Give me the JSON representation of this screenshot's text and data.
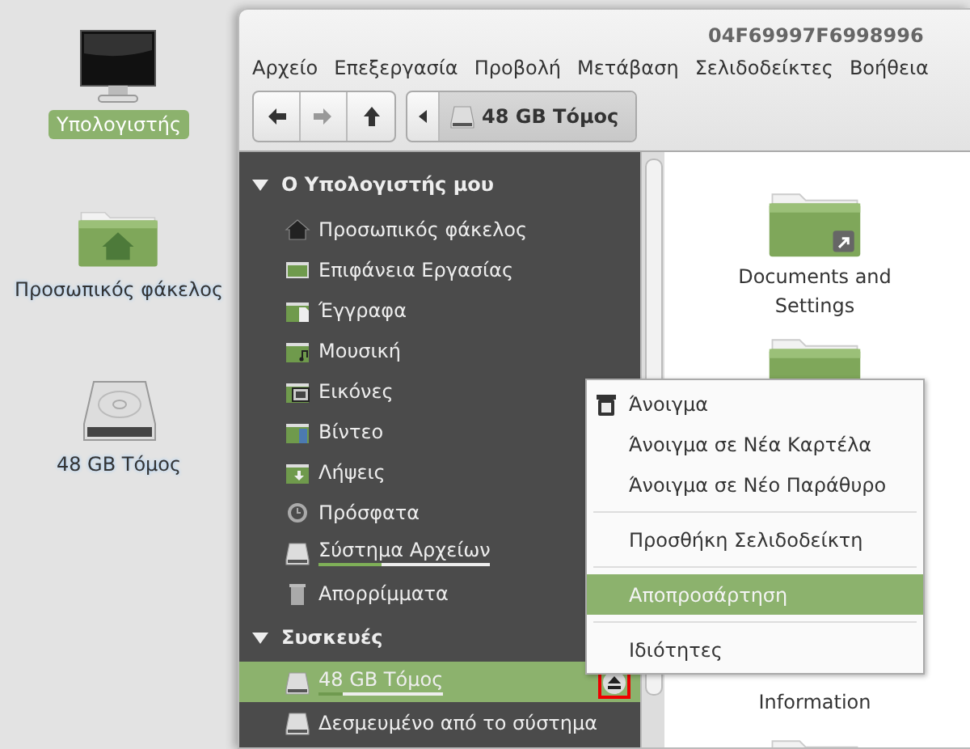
{
  "desktop": {
    "icons": [
      {
        "kind": "computer",
        "label": "Υπολογιστής",
        "selected": true
      },
      {
        "kind": "home",
        "label": "Προσωπικός φάκελος",
        "selected": false
      },
      {
        "kind": "drive",
        "label": "48 GB Τόμος",
        "selected": false
      }
    ]
  },
  "window": {
    "title": "04F69997F6998996",
    "menu": [
      "Αρχείο",
      "Επεξεργασία",
      "Προβολή",
      "Μετάβαση",
      "Σελιδοδείκτες",
      "Βοήθεια"
    ],
    "toolbar": [
      {
        "kind": "back",
        "disabled": false
      },
      {
        "kind": "forward",
        "disabled": true
      },
      {
        "kind": "up",
        "disabled": false
      }
    ],
    "path": [
      {
        "label": "48 GB Τόμος",
        "selected": true
      }
    ],
    "sidebar": {
      "sections": [
        {
          "title": "Ο Υπολογιστής μου",
          "expanded": true,
          "items": [
            {
              "kind": "home",
              "label": "Προσωπικός φάκελος",
              "selected": false
            },
            {
              "kind": "desktop",
              "label": "Επιφάνεια Εργασίας",
              "selected": false
            },
            {
              "kind": "documents",
              "label": "Έγγραφα",
              "selected": false
            },
            {
              "kind": "music",
              "label": "Μουσική",
              "selected": false
            },
            {
              "kind": "pictures",
              "label": "Εικόνες",
              "selected": false
            },
            {
              "kind": "videos",
              "label": "Βίντεο",
              "selected": false
            },
            {
              "kind": "downloads",
              "label": "Λήψεις",
              "selected": false
            },
            {
              "kind": "recent",
              "label": "Πρόσφατα",
              "selected": false
            },
            {
              "kind": "drive",
              "label": "Σύστημα Αρχείων",
              "selected": false,
              "level": 0.37
            },
            {
              "kind": "trash",
              "label": "Απορρίμματα",
              "selected": false
            }
          ]
        },
        {
          "title": "Συσκευές",
          "expanded": true,
          "items": [
            {
              "kind": "drive",
              "label": "48 GB Τόμος",
              "selected": true,
              "level": 0.2,
              "eject": true,
              "eject_highlighted": true
            },
            {
              "kind": "drive",
              "label": "Δεσμευμένο από το σύστημα",
              "selected": false
            }
          ]
        }
      ]
    }
  },
  "files": [
    {
      "kind": "link-folder",
      "name": "Documents and Settings"
    },
    {
      "kind": "folder"
    },
    {
      "name": "Information"
    },
    {
      "kind": "folder"
    }
  ],
  "context_menu": [
    {
      "kind": "item",
      "label": "Άνοιγμα",
      "icon": true,
      "selected": false
    },
    {
      "kind": "item",
      "label": "Άνοιγμα σε Νέα Καρτέλα",
      "selected": false
    },
    {
      "kind": "item",
      "label": "Άνοιγμα σε Νέο Παράθυρο",
      "selected": false
    },
    {
      "kind": "separator"
    },
    {
      "kind": "item",
      "label": "Προσθήκη Σελιδοδείκτη",
      "selected": false
    },
    {
      "kind": "separator"
    },
    {
      "kind": "item",
      "label": "Αποπροσάρτηση",
      "selected": true
    },
    {
      "kind": "separator"
    },
    {
      "kind": "item",
      "label": "Ιδιότητες",
      "selected": false
    }
  ]
}
